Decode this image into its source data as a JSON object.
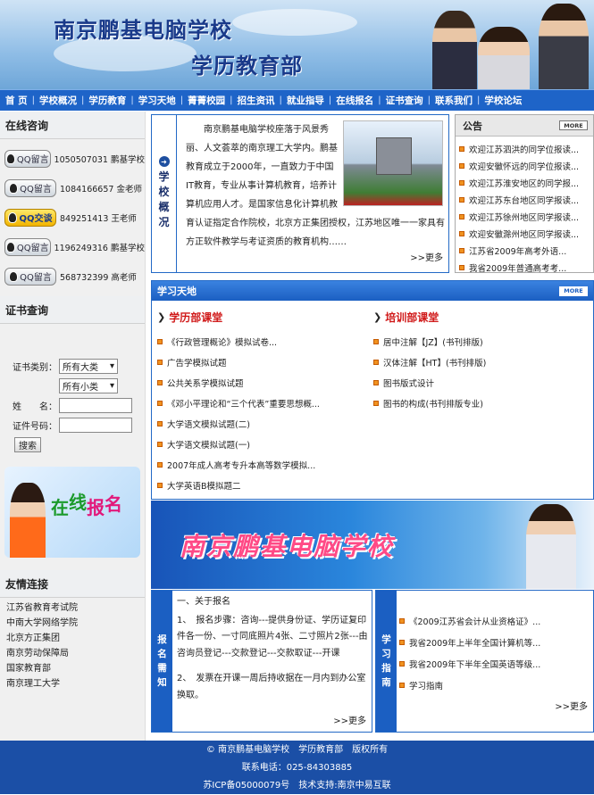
{
  "header": {
    "school_name": "南京鹏基电脑学校",
    "department": "学历教育部"
  },
  "nav": [
    "首 页",
    "学校概况",
    "学历教育",
    "学习天地",
    "菁菁校园",
    "招生资讯",
    "就业指导",
    "在线报名",
    "证书查询",
    "联系我们",
    "学校论坛"
  ],
  "online_consult": {
    "title": "在线咨询",
    "items": [
      {
        "button": "QQ留言",
        "text": "1050507031 鹏基学校",
        "style": "gray"
      },
      {
        "button": "QQ留言",
        "text": "1084166657 金老师",
        "style": "gray"
      },
      {
        "button": "QQ交谈",
        "text": "849251413 王老师",
        "style": "yellow"
      },
      {
        "button": "QQ留言",
        "text": "1196249316 鹏基学校",
        "style": "gray"
      },
      {
        "button": "QQ留言",
        "text": "568732399 高老师",
        "style": "gray"
      }
    ]
  },
  "cert_query": {
    "title": "证书查询",
    "type_label": "证书类别：",
    "type_value": "所有大类",
    "subtype_value": "所有小类",
    "name_label": "姓　　名：",
    "number_label": "证件号码：",
    "search_label": "搜索"
  },
  "signup_banner": "在线报名",
  "friend_links": {
    "title": "友情连接",
    "items": [
      "江苏省教育考试院",
      "中南大学网络学院",
      "北京方正集团",
      "南京劳动保障局",
      "国家教育部",
      "南京理工大学"
    ]
  },
  "intro": {
    "vertical_title": [
      "学",
      "校",
      "概",
      "况"
    ],
    "text": "南京鹏基电脑学校座落于风景秀丽、人文荟萃的南京理工大学内。鹏基教育成立于2000年，一直致力于中国IT教育，专业从事计算机教育，培养计算机应用人才。是国家信息化计算机教育认证指定合作院校，北京方正集团授权，江苏地区唯一一家具有方正软件教学与考证资质的教育机构……",
    "more": ">>更多"
  },
  "notice": {
    "title": "公告",
    "more": "MORE",
    "items": [
      "欢迎江苏泗洪的同学位报读...",
      "欢迎安徽怀远的同学位报读...",
      "欢迎江苏淮安地区的同学报...",
      "欢迎江苏东台地区同学报读...",
      "欢迎江苏徐州地区同学报读...",
      "欢迎安徽滁州地区同学报读...",
      "江苏省2009年高考外语...",
      "我省2009年普通高考考..."
    ]
  },
  "study": {
    "title": "学习天地",
    "more": "MORE",
    "left_title": "学历部课堂",
    "left_items": [
      "《行政管理概论》模拟试卷...",
      "广告学模拟试题",
      "公共关系学模拟试题",
      "《邓小平理论和“三个代表”重要思想概...",
      "大学语文模拟试题(二)",
      "大学语文模拟试题(一)",
      "2007年成人高考专升本高等数学模拟...",
      "大学英语B模拟题二"
    ],
    "right_title": "培训部课堂",
    "right_items": [
      "居中注解【JZ】(书刊排版)",
      "汉体注解【HT】(书刊排版)",
      "图书版式设计",
      "图书的构成(书刊排版专业)"
    ]
  },
  "banner_title": "南京鹏基电脑学校",
  "registration": {
    "vertical_title": [
      "报",
      "名",
      "需",
      "知"
    ],
    "lines": [
      "一、关于报名",
      "1、　报名步骤：咨询---提供身份证、学历证复印件各一份、一寸同底照片4张、二寸照片2张---由咨询员登记---交款登记---交款取证---开课",
      "2、　发票在开课一周后持收据在一月内到办公室换取。"
    ],
    "more": ">>更多"
  },
  "guide": {
    "vertical_title": [
      "学",
      "习",
      "指",
      "南"
    ],
    "items": [
      "《2009江苏省会计从业资格证》...",
      "我省2009年上半年全国计算机等...",
      "我省2009年下半年全国英语等级...",
      "学习指南"
    ],
    "more": ">>更多"
  },
  "footer": {
    "line1": "© 南京鹏基电脑学校　学历教育部　版权所有",
    "line2": "联系电话：025-84303885",
    "line3": "苏ICP备05000079号　技术支持:南京中易互联"
  },
  "colors": {
    "nav_blue": "#1e64c8",
    "accent_orange": "#f09220",
    "accent_red": "#d01818",
    "footer_blue": "#1b4fa6"
  }
}
